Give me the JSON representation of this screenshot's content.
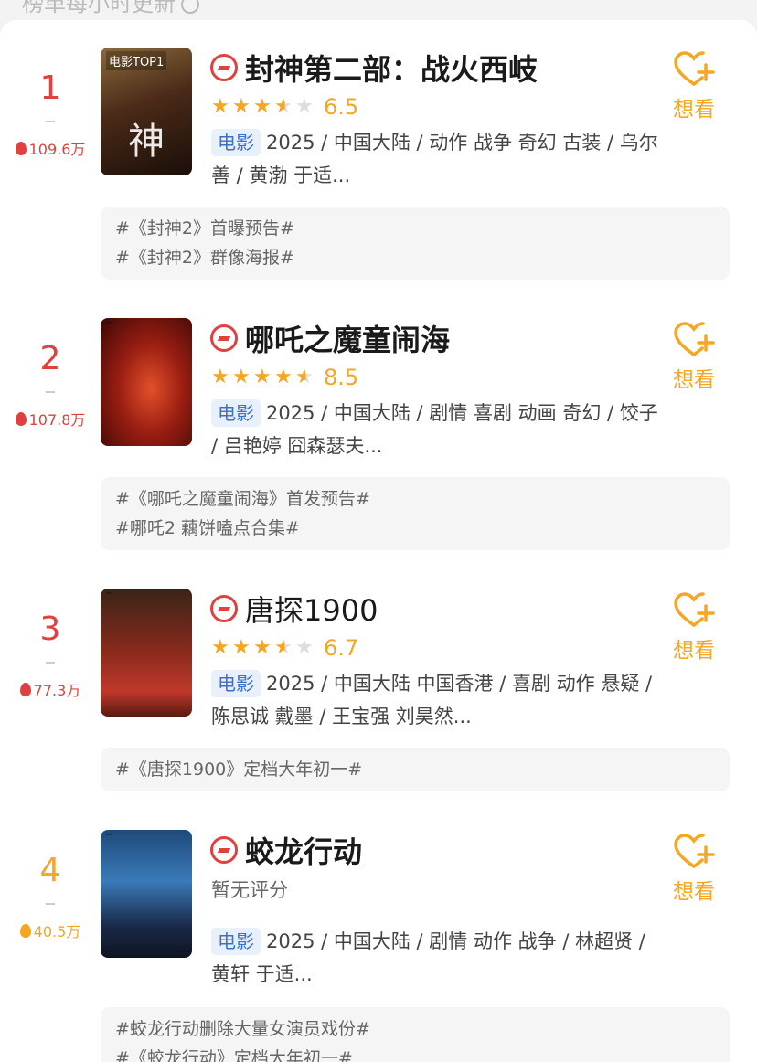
{
  "header": {
    "update_note": "榜单每小时更新"
  },
  "movies": [
    {
      "rank": "1",
      "rank_color": "#e0403e",
      "heat": "109.6万",
      "poster_tag": "电影TOP1",
      "poster_glyph": "神",
      "title": "封神第二部：战火西岐",
      "rating": "6.5",
      "stars": 3.5,
      "no_rating": "",
      "type": "电影",
      "info": "2025 / 中国大陆 / 动作 战争 奇幻 古装 / 乌尔善 / 黄渤 于适...",
      "want_label": "想看",
      "topics": [
        "#《封神2》首曝预告#",
        "#《封神2》群像海报#"
      ]
    },
    {
      "rank": "2",
      "rank_color": "#e0403e",
      "heat": "107.8万",
      "poster_tag": "",
      "poster_glyph": "",
      "title": "哪吒之魔童闹海",
      "rating": "8.5",
      "stars": 4.5,
      "no_rating": "",
      "type": "电影",
      "info": "2025 / 中国大陆 / 剧情 喜剧 动画 奇幻 / 饺子 / 吕艳婷 囧森瑟夫...",
      "want_label": "想看",
      "topics": [
        "#《哪吒之魔童闹海》首发预告#",
        "#哪吒2 藕饼嗑点合集#"
      ]
    },
    {
      "rank": "3",
      "rank_color": "#e0403e",
      "heat": "77.3万",
      "poster_tag": "",
      "poster_glyph": "",
      "title": "唐探1900",
      "rating": "6.7",
      "stars": 3.5,
      "no_rating": "",
      "type": "电影",
      "info": "2025 / 中国大陆 中国香港 / 喜剧 动作 悬疑 / 陈思诚 戴墨 / 王宝强 刘昊然...",
      "want_label": "想看",
      "topics": [
        "#《唐探1900》定档大年初一#"
      ]
    },
    {
      "rank": "4",
      "rank_color": "#f5a623",
      "heat": "40.5万",
      "poster_tag": "",
      "poster_glyph": "",
      "title": "蛟龙行动",
      "rating": "",
      "stars": 0,
      "no_rating": "暂无评分",
      "type": "电影",
      "info": "2025 / 中国大陆 / 剧情 动作 战争 / 林超贤 / 黄轩 于适...",
      "want_label": "想看",
      "topics": [
        "#蛟龙行动删除大量女演员戏份#",
        "#《蛟龙行动》定档大年初一#"
      ]
    }
  ],
  "colors": {
    "accent": "#f5a623",
    "rank_top": "#e0403e",
    "brand": "#e0403e",
    "type_tag": "#3d6fc8"
  }
}
